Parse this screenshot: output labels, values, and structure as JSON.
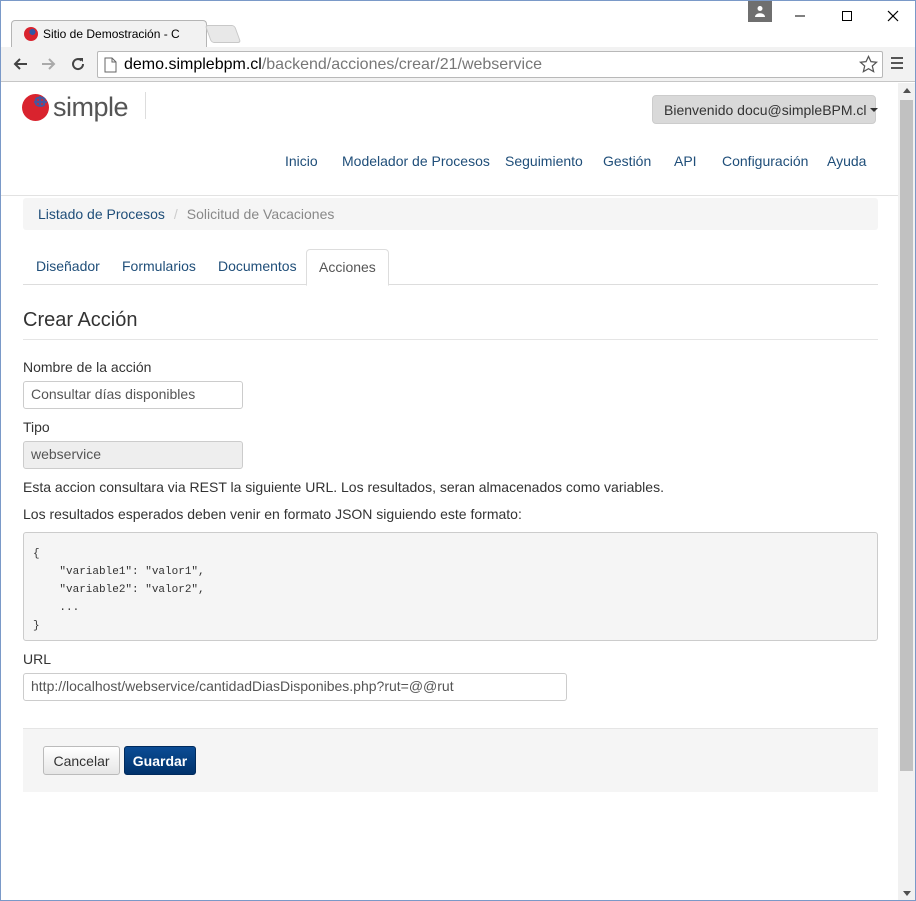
{
  "browser": {
    "tab_title": "Sitio de Demostración - C",
    "url_host": "demo.simplebpm.cl",
    "url_path": "/backend/acciones/crear/21/webservice",
    "icons": [
      "back-icon",
      "forward-icon",
      "reload-icon",
      "page-icon",
      "star-icon",
      "menu-icon",
      "minimize-icon",
      "maximize-icon",
      "close-icon",
      "profile-icon"
    ]
  },
  "header": {
    "logo_text": "simple",
    "user_menu": "Bienvenido docu@simpleBPM.cl",
    "nav": [
      "Inicio",
      "Modelador de Procesos",
      "Seguimiento",
      "Gestión",
      "API",
      "Configuración",
      "Ayuda"
    ]
  },
  "breadcrumb": {
    "link": "Listado de Procesos",
    "separator": "/",
    "active": "Solicitud de Vacaciones"
  },
  "tabs": [
    "Diseñador",
    "Formularios",
    "Documentos",
    "Acciones"
  ],
  "active_tab": "Acciones",
  "form": {
    "legend": "Crear Acción",
    "name_label": "Nombre de la acción",
    "name_value": "Consultar días disponibles",
    "type_label": "Tipo",
    "type_value": "webservice",
    "help1": "Esta accion consultara via REST la siguiente URL. Los resultados, seran almacenados como variables.",
    "help2": "Los resultados esperados deben venir en formato JSON siguiendo este formato:",
    "code_lines": [
      "{",
      "    \"variable1\": \"valor1\",",
      "    \"variable2\": \"valor2\",",
      "    ...",
      "}"
    ],
    "url_label": "URL",
    "url_value": "http://localhost/webservice/cantidadDiasDisponibes.php?rut=@@rut",
    "cancel": "Cancelar",
    "save": "Guardar"
  },
  "colors": {
    "link": "#1f4e79",
    "primary_button": "#00326b",
    "logo_red": "#d9232e"
  }
}
